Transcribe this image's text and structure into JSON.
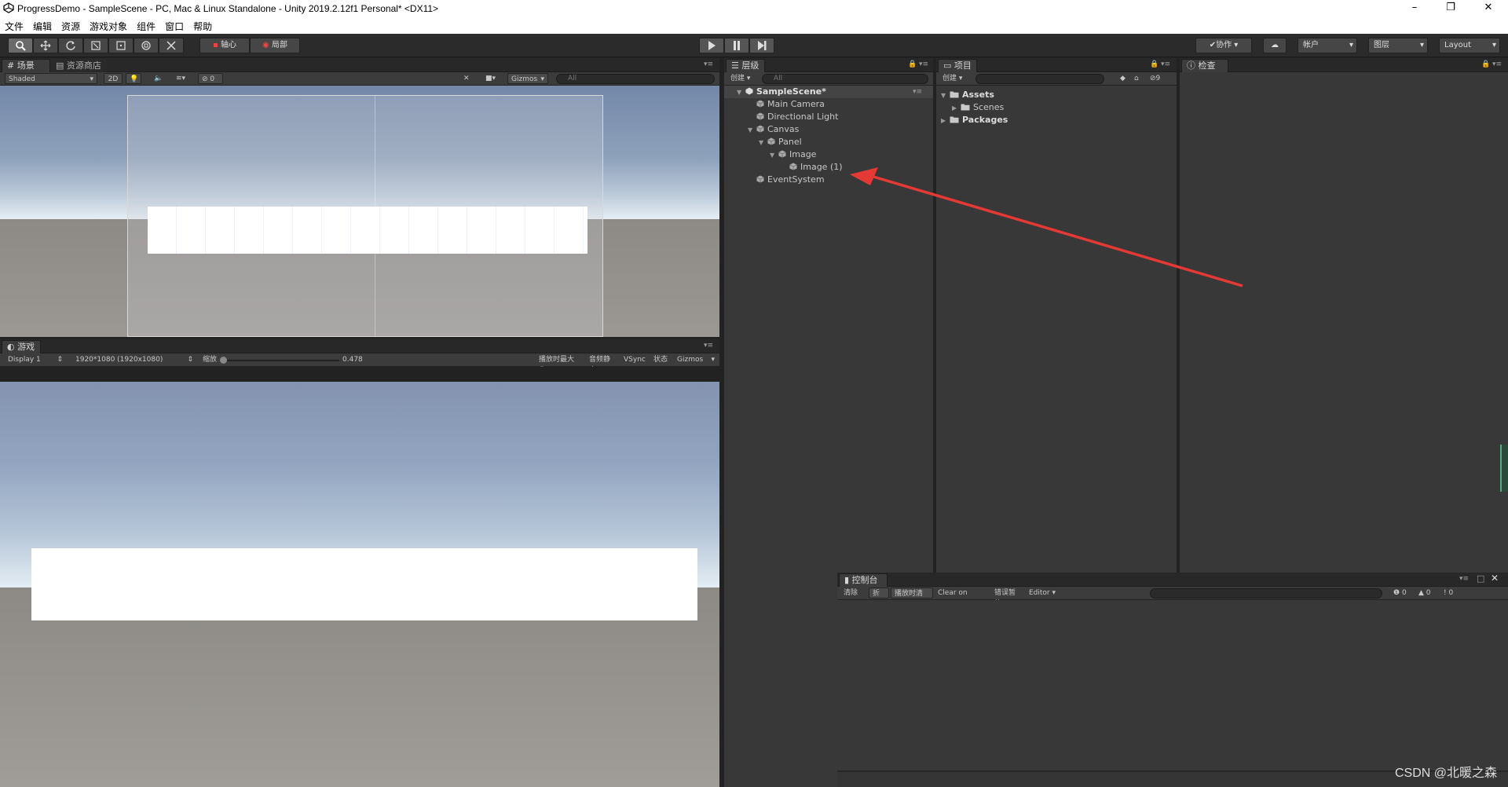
{
  "window": {
    "title": "ProgressDemo - SampleScene - PC, Mac & Linux Standalone - Unity 2019.2.12f1 Personal* <DX11>",
    "minimize": "–",
    "maximize": "❐",
    "close": "✕"
  },
  "menu": [
    "文件",
    "编辑",
    "资源",
    "游戏对象",
    "组件",
    "窗口",
    "帮助"
  ],
  "toolbar": {
    "pivot": "轴心",
    "local": "局部",
    "collab": "协作",
    "account": "帐户",
    "layers": "图层",
    "layout": "Layout"
  },
  "scene": {
    "tab": "场景",
    "tab_store": "资源商店",
    "shading": "Shaded",
    "mode2d": "2D",
    "hidden_count": "0",
    "gizmos": "Gizmos",
    "search_placeholder": "All"
  },
  "game": {
    "tab": "游戏",
    "display": "Display 1",
    "resolution": "1920*1080 (1920x1080)",
    "scale_label": "缩放",
    "scale_value": "0.478",
    "maximize_on_play": "播放时最大化",
    "mute_audio": "音频静音",
    "vsync": "VSync",
    "stats": "状态",
    "gizmos": "Gizmos"
  },
  "hierarchy": {
    "tab": "层级",
    "create": "创建",
    "search_placeholder": "All",
    "items": [
      {
        "label": "SampleScene*",
        "depth": 0,
        "fold": "open",
        "scene": true
      },
      {
        "label": "Main Camera",
        "depth": 1,
        "fold": "none"
      },
      {
        "label": "Directional Light",
        "depth": 1,
        "fold": "none"
      },
      {
        "label": "Canvas",
        "depth": 1,
        "fold": "open"
      },
      {
        "label": "Panel",
        "depth": 2,
        "fold": "open"
      },
      {
        "label": "Image",
        "depth": 3,
        "fold": "open"
      },
      {
        "label": "Image (1)",
        "depth": 4,
        "fold": "none"
      },
      {
        "label": "EventSystem",
        "depth": 1,
        "fold": "none"
      }
    ]
  },
  "project": {
    "tab": "项目",
    "create": "创建",
    "hidden_count": "9",
    "items": [
      {
        "label": "Assets",
        "depth": 0,
        "fold": "open",
        "bold": true
      },
      {
        "label": "Scenes",
        "depth": 1,
        "fold": "closed",
        "bold": false
      },
      {
        "label": "Packages",
        "depth": 0,
        "fold": "closed",
        "bold": true
      }
    ]
  },
  "inspector": {
    "tab": "检查器"
  },
  "console": {
    "tab": "控制台",
    "clear": "清除",
    "collapse": "折叠",
    "clear_on_play": "播放时清除",
    "clear_on_build": "Clear on Build",
    "error_pause": "错误暂停",
    "editor": "Editor",
    "log_count": "0",
    "warn_count": "0",
    "error_count": "0"
  },
  "watermark": "CSDN @北暖之森",
  "colors": {
    "arrow": "#e53935",
    "panel_bg": "#383838",
    "toolbar_bg": "#2b2b2b"
  }
}
